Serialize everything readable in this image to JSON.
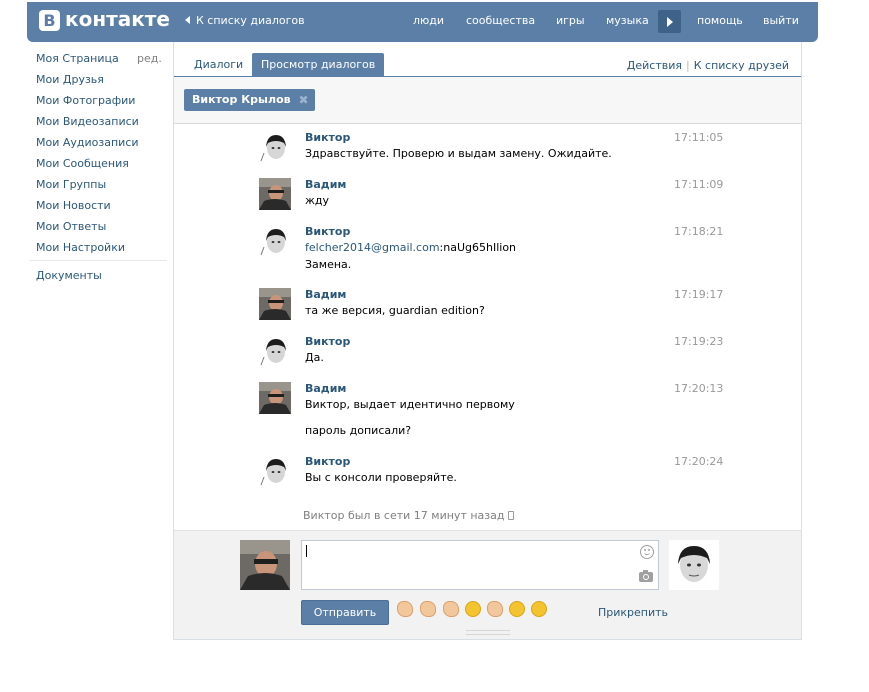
{
  "header": {
    "logo_letter": "В",
    "logo_text": "контакте",
    "back_link": "К списку диалогов",
    "nav": [
      "люди",
      "сообщества",
      "игры",
      "музыка",
      "помощь",
      "выйти"
    ]
  },
  "sidebar": {
    "edit_label": "ред.",
    "items": [
      "Моя Страница",
      "Мои Друзья",
      "Мои Фотографии",
      "Мои Видеозаписи",
      "Мои Аудиозаписи",
      "Мои Сообщения",
      "Мои Группы",
      "Мои Новости",
      "Мои Ответы",
      "Мои Настройки"
    ],
    "extra_items": [
      "Документы"
    ]
  },
  "tabs": {
    "items": [
      "Диалоги",
      "Просмотр диалогов"
    ],
    "active_index": 1,
    "actions": [
      "Действия",
      "К списку друзей"
    ],
    "actions_separator": "|"
  },
  "filter": {
    "chip_label": "Виктор Крылов",
    "chip_close": "✖"
  },
  "messages": [
    {
      "author": "Виктор",
      "time": "17:11:05",
      "avatar": "viktor",
      "lines": [
        {
          "text": "Здравствуйте. Проверю и выдам замену. Ожидайте."
        }
      ]
    },
    {
      "author": "Вадим",
      "time": "17:11:09",
      "avatar": "vadim",
      "lines": [
        {
          "text": "жду"
        }
      ]
    },
    {
      "author": "Виктор",
      "time": "17:18:21",
      "avatar": "viktor",
      "lines": [
        {
          "link": "felcher2014@gmail.com",
          "text": ":naUg65hIlion"
        },
        {
          "text": "Замена."
        }
      ]
    },
    {
      "author": "Вадим",
      "time": "17:19:17",
      "avatar": "vadim",
      "lines": [
        {
          "text": "та же версия, guardian edition?"
        }
      ]
    },
    {
      "author": "Виктор",
      "time": "17:19:23",
      "avatar": "viktor",
      "lines": [
        {
          "text": "Да."
        }
      ]
    },
    {
      "author": "Вадим",
      "time": "17:20:13",
      "avatar": "vadim",
      "lines": [
        {
          "text": "Виктор, выдает идентично первому"
        },
        {
          "text": "пароль дописали?"
        }
      ]
    },
    {
      "author": "Виктор",
      "time": "17:20:24",
      "avatar": "viktor",
      "lines": [
        {
          "text": "Вы с консоли проверяйте."
        }
      ]
    }
  ],
  "status_text": "Виктор был в сети 17 минут назад",
  "composer": {
    "input_value": "",
    "send_label": "Отправить",
    "attach_label": "Прикрепить",
    "emoji_icons": [
      "thumbs-up-icon",
      "fist-icon",
      "muscle-icon",
      "joy-face-icon",
      "ok-hand-icon",
      "laughing-face-icon",
      "astonished-face-icon"
    ]
  },
  "colors": {
    "brand": "#5b7fa6",
    "link": "#2b587a",
    "muted": "#999999"
  }
}
